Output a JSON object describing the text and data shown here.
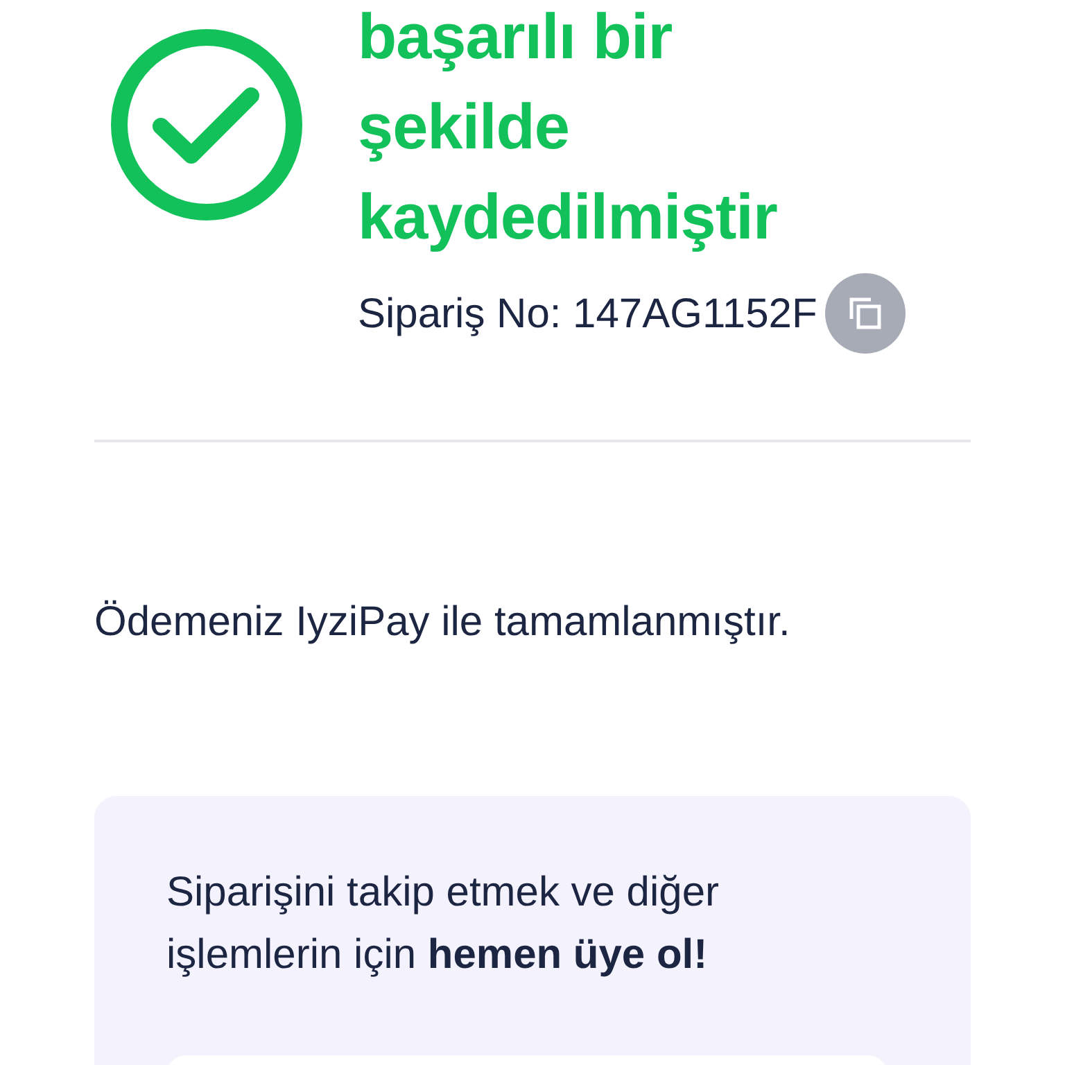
{
  "success": {
    "heading_lines": [
      "başarılı bir",
      "şekilde",
      "kaydedilmiştir"
    ],
    "order_label": "Sipariş No: 147AG1152F"
  },
  "payment_message": "Ödemeniz IyziPay ile tamamlanmıştır.",
  "signup_card": {
    "text": "Siparişini takip etmek ve diğer işlemlerin için **hemen üye ol!**"
  }
}
